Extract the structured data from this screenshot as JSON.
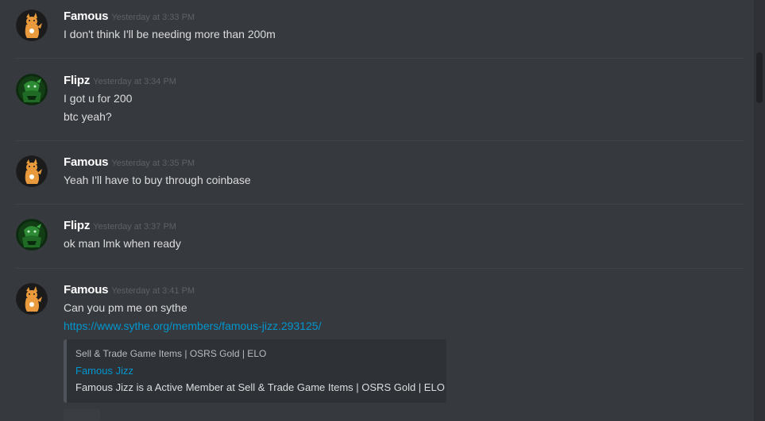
{
  "messages": [
    {
      "author": "Famous",
      "timestamp": "Yesterday at 3:33 PM",
      "avatar_icon": "orange-cat-avatar-icon",
      "lines": [
        "I don't think I'll be needing more than 200m"
      ]
    },
    {
      "author": "Flipz",
      "timestamp": "Yesterday at 3:34 PM",
      "avatar_icon": "green-character-avatar-icon",
      "lines": [
        "I got u for 200",
        "btc yeah?"
      ]
    },
    {
      "author": "Famous",
      "timestamp": "Yesterday at 3:35 PM",
      "avatar_icon": "orange-cat-avatar-icon",
      "lines": [
        "Yeah I'll have to buy through coinbase"
      ]
    },
    {
      "author": "Flipz",
      "timestamp": "Yesterday at 3:37 PM",
      "avatar_icon": "green-character-avatar-icon",
      "lines": [
        "ok man lmk when ready"
      ]
    },
    {
      "author": "Famous",
      "timestamp": "Yesterday at 3:41 PM",
      "avatar_icon": "orange-cat-avatar-icon",
      "lines": [
        "Can you pm me on sythe"
      ],
      "link": "https://www.sythe.org/members/famous-jizz.293125/",
      "embed": {
        "provider": "Sell & Trade Game Items | OSRS Gold | ELO",
        "title": "Famous Jizz",
        "description": "Famous Jizz is a Active Member at Sell & Trade Game Items | OSRS Gold | ELO"
      }
    }
  ],
  "colors": {
    "background": "#36393e",
    "username": "#ffffff",
    "timestamp": "#5e6167",
    "message_text": "#dcddde",
    "link": "#0096cf",
    "embed_background": "#2e3136",
    "embed_border": "#4f545c"
  }
}
